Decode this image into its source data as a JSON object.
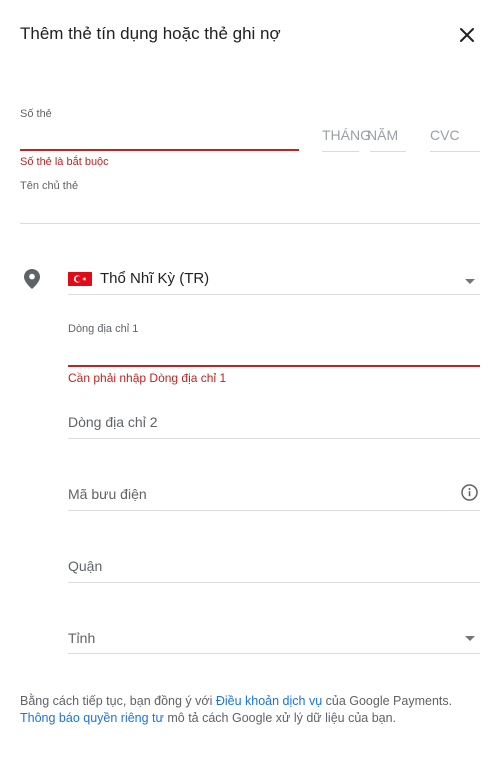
{
  "dialog": {
    "title": "Thêm thẻ tín dụng hoặc thẻ ghi nợ"
  },
  "card": {
    "number_label": "Số thẻ",
    "number_error": "Số thẻ là bắt buộc",
    "month_placeholder": "THÁNG",
    "year_placeholder": "NĂM",
    "cvc_placeholder": "CVC",
    "holder_label": "Tên chủ thẻ"
  },
  "address": {
    "country": "Thổ Nhĩ Kỳ (TR)",
    "line1_label": "Dòng địa chỉ 1",
    "line1_error": "Cần phải nhập Dòng địa chỉ 1",
    "line2_placeholder": "Dòng địa chỉ 2",
    "postal_placeholder": "Mã bưu điện",
    "district_placeholder": "Quận",
    "province_placeholder": "Tỉnh"
  },
  "footer": {
    "text_1": "Bằng cách tiếp tục, bạn đồng ý với ",
    "terms_link": "Điều khoản dịch vụ",
    "text_2": " của Google Payments. ",
    "privacy_link": "Thông báo quyền riêng tư",
    "text_3": " mô tả cách Google xử lý dữ liệu của bạn."
  },
  "icons": {
    "close": "close-icon",
    "location": "location-pin-icon",
    "info": "info-icon",
    "country_flag": "turkey-flag-icon"
  },
  "colors": {
    "error": "#c5221f",
    "link": "#1a73e8"
  }
}
